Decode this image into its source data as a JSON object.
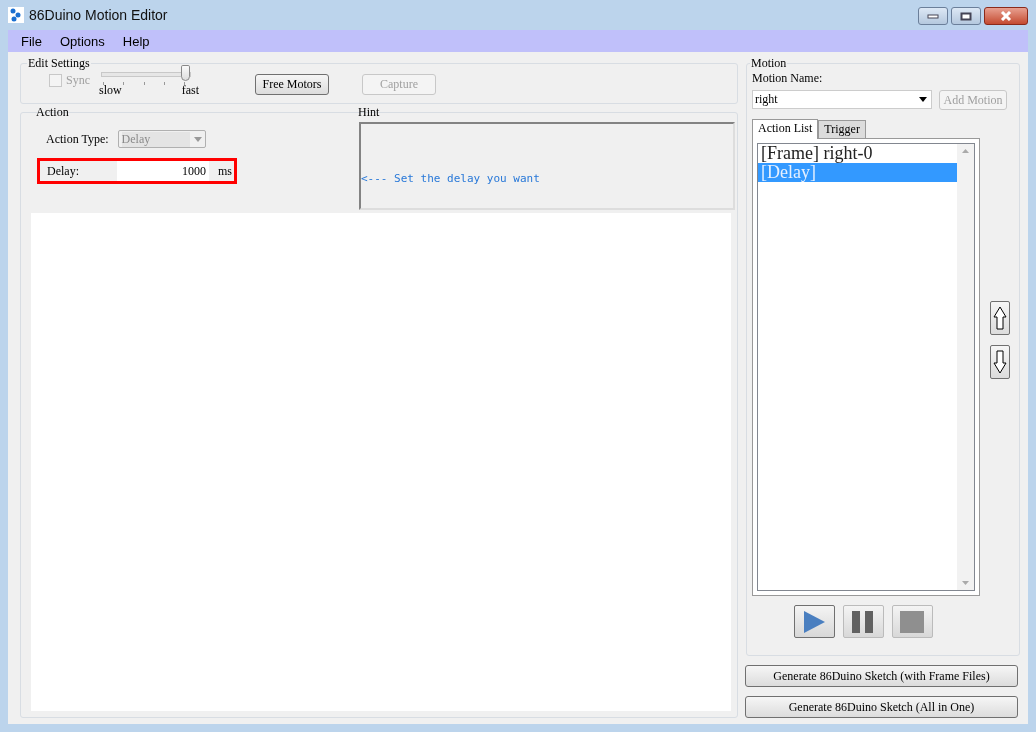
{
  "window": {
    "title": "86Duino Motion Editor"
  },
  "menu": [
    "File",
    "Options",
    "Help"
  ],
  "edit_settings": {
    "title": "Edit Settings",
    "sync": {
      "label": "Sync",
      "checked": false,
      "disabled": true
    },
    "speed": {
      "level": 1,
      "min_label": "slow",
      "max_label": "fast"
    },
    "buttons": [
      {
        "label": "Free Motors",
        "disabled": false
      },
      {
        "label": "Capture",
        "disabled": true
      }
    ]
  },
  "action": {
    "title": "Action",
    "type_label": "Action Type:",
    "type_value": "Delay",
    "type_disabled": true,
    "delay_label": "Delay:",
    "delay_value": "1000",
    "delay_unit": "ms",
    "highlighted": true
  },
  "hint": {
    "title": "Hint",
    "text": "<--- Set the delay you want"
  },
  "motion": {
    "title": "Motion",
    "name_label": "Motion Name:",
    "name_value": "right",
    "add_button": {
      "label": "Add Motion",
      "disabled": true
    },
    "tabs": [
      {
        "label": "Action List",
        "selected": true
      },
      {
        "label": "Trigger",
        "selected": false
      }
    ],
    "items": [
      {
        "text": "[Frame] right-0",
        "selected": false
      },
      {
        "text": "[Delay]",
        "selected": true
      }
    ],
    "player": [
      {
        "kind": "play",
        "disabled": false
      },
      {
        "kind": "pause",
        "disabled": true
      },
      {
        "kind": "stop",
        "disabled": true
      }
    ]
  },
  "generate_buttons": [
    "Generate 86Duino Sketch (with Frame Files)",
    "Generate 86Duino Sketch (All in One)"
  ]
}
